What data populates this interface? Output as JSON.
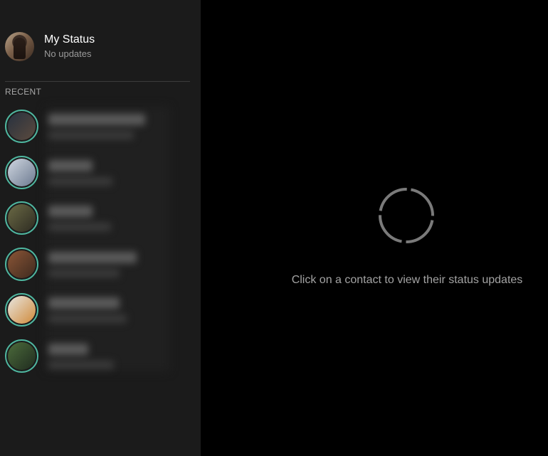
{
  "my_status": {
    "title": "My Status",
    "subtitle": "No updates"
  },
  "recent": {
    "label": "RECENT",
    "items": [
      {
        "avatar_colors": [
          "#27313f",
          "#5b4a3e"
        ],
        "ring_color": "#4fb7a0"
      },
      {
        "avatar_colors": [
          "#cfd6e0",
          "#6c7a90"
        ],
        "ring_color": "#4fb7a0"
      },
      {
        "avatar_colors": [
          "#6b6a45",
          "#2d2b22"
        ],
        "ring_color": "#4fb7a0"
      },
      {
        "avatar_colors": [
          "#8a5536",
          "#3e2a1f"
        ],
        "ring_color": "#4fb7a0"
      },
      {
        "avatar_colors": [
          "#e8e6e1",
          "#d08a3a"
        ],
        "ring_color": "#4fb7a0"
      },
      {
        "avatar_colors": [
          "#4c6b3b",
          "#1f2b1f"
        ],
        "ring_color": "#4fb7a0"
      }
    ]
  },
  "main": {
    "hint": "Click on a contact to view their status updates"
  },
  "colors": {
    "sidebar_bg": "#1b1b1b",
    "main_bg": "#000000",
    "accent_ring": "#4fb7a0",
    "spinner": "#7a7a7a"
  },
  "icons": {
    "spinner": "loading-spinner-icon"
  }
}
